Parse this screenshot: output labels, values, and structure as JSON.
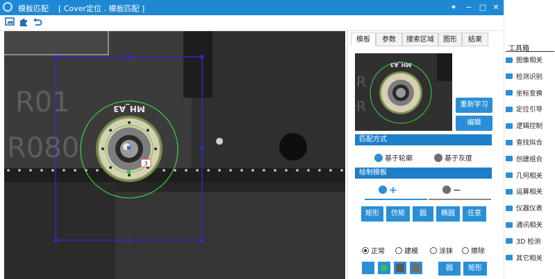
{
  "window": {
    "title": "模板匹配    [ Cover定位 . 模板匹配 ]",
    "pin_icon": "pin-icon",
    "minimize_icon": "minimize-icon",
    "maximize_icon": "maximize-icon",
    "close_icon": "close-icon"
  },
  "toolbar": {
    "icons": [
      "image-icon",
      "puzzle-icon",
      "undo-icon"
    ]
  },
  "canvas": {
    "engraved_text_1": "R01",
    "engraved_text_2": "R080",
    "part_label": "MH_A3",
    "marker_label": "3"
  },
  "tabs": [
    "模板",
    "参数",
    "搜索区域",
    "图形",
    "结果"
  ],
  "active_tab": "模板",
  "buttons": {
    "relearn": "重新学习",
    "edit": "编辑"
  },
  "match_mode": {
    "title": "匹配方式",
    "options": [
      "基于轮廓",
      "基于灰度"
    ]
  },
  "draw_template": {
    "title": "绘制模板",
    "add_symbol": "+",
    "remove_symbol": "−",
    "shapes": [
      "矩形",
      "仿矩",
      "圆",
      "椭圆",
      "任意"
    ],
    "modes": [
      "正常",
      "建模",
      "涂抹",
      "擦除"
    ],
    "selected_mode": "正常",
    "bottom_buttons": [
      "圆",
      "矩形"
    ]
  },
  "colors": {
    "title_bar": "#1e88d4",
    "accent": "#2a8fd6",
    "roi_rect": "#2b2bd0",
    "contour_green": "#3cd63c",
    "swatches": [
      "#2a8fd6",
      "#2ecc40",
      "#5a5a5a",
      "#6e6e6e"
    ]
  },
  "toolbox": {
    "title": "工具箱",
    "items": [
      "图像相关",
      "检测识别",
      "坐标变换",
      "定位引导",
      "逻辑控制",
      "查找拟合",
      "创建组合",
      "几何相关",
      "运算相关",
      "仪器仪表",
      "通讯相关",
      "3D 检测",
      "其它相关"
    ]
  }
}
